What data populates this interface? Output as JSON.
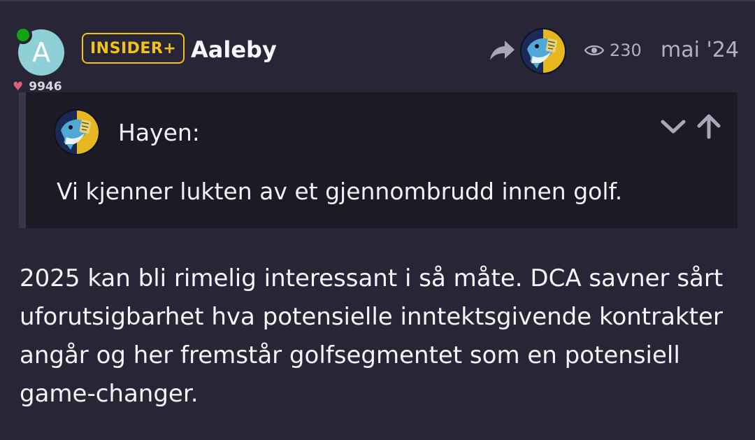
{
  "post": {
    "avatar_letter": "A",
    "likes": "9946",
    "badge": "INSIDER+",
    "username": "Aaleby",
    "views": "230",
    "date": "mai '24",
    "quote": {
      "author": "Hayen:",
      "text": "Vi kjenner lukten av et gjennombrudd innen golf."
    },
    "body": "2025 kan bli rimelig interessant i så måte. DCA savner sårt uforutsigbarhet hva potensielle inntektsgivende kontrakter angår og her fremstår golfsegmentet som en potensiell game-changer."
  },
  "icons": {
    "share": "share-icon",
    "views": "eye-icon",
    "collapse": "chevron-down-icon",
    "jump": "arrow-up-icon",
    "likes": "heart-icon"
  },
  "colors": {
    "background": "#272536",
    "quote_background": "#1b1a25",
    "badge": "#f1c21a",
    "online": "#13a413",
    "avatar": "#8ed0d6",
    "heart": "#d9607d"
  }
}
